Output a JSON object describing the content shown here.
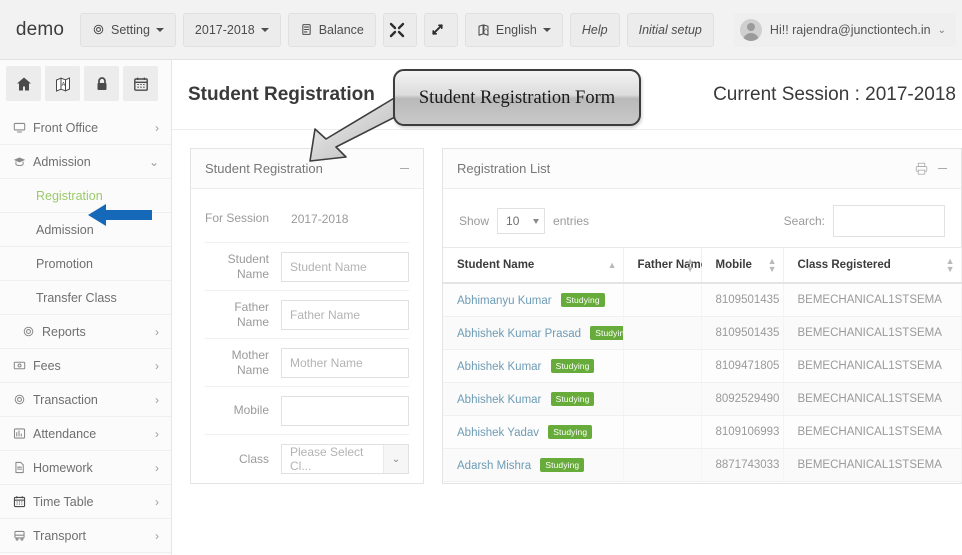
{
  "topbar": {
    "brand": "demo",
    "buttons": [
      {
        "label": "Setting",
        "icon": "gear-icon",
        "caret": true,
        "name": "setting-button"
      },
      {
        "label": "2017-2018",
        "icon": "",
        "caret": true,
        "name": "session-button"
      },
      {
        "label": "Balance",
        "icon": "database-icon",
        "caret": false,
        "name": "balance-button"
      },
      {
        "label": "",
        "icon": "expand-icon",
        "caret": false,
        "name": "expand-button"
      },
      {
        "label": "",
        "icon": "resize-icon",
        "caret": false,
        "name": "resize-button"
      },
      {
        "label": "English",
        "icon": "language-icon",
        "caret": true,
        "name": "language-button"
      },
      {
        "label": "Help",
        "icon": "",
        "caret": false,
        "name": "help-button"
      },
      {
        "label": "Initial setup",
        "icon": "",
        "caret": false,
        "name": "initial-setup-button"
      }
    ],
    "user": {
      "greeting": "Hi!! rajendra@junctiontech.in",
      "caret": "⌄"
    }
  },
  "sidebar": {
    "quick_icons": [
      "home-icon",
      "map-icon",
      "lock-icon",
      "calendar-icon"
    ],
    "items": [
      {
        "label": "Front Office",
        "icon": "monitor-icon",
        "chevron": "›",
        "sub": false,
        "active": false
      },
      {
        "label": "Admission",
        "icon": "graduation-cap-icon",
        "chevron": "⌄",
        "sub": false,
        "active": false
      },
      {
        "label": "Registration",
        "icon": "",
        "chevron": "",
        "sub": true,
        "active": true
      },
      {
        "label": "Admission",
        "icon": "",
        "chevron": "",
        "sub": true,
        "active": false
      },
      {
        "label": "Promotion",
        "icon": "",
        "chevron": "",
        "sub": true,
        "active": false
      },
      {
        "label": "Transfer Class",
        "icon": "",
        "chevron": "",
        "sub": true,
        "active": false
      },
      {
        "label": "Reports",
        "icon": "gear-icon",
        "chevron": "›",
        "sub": true,
        "active": false
      },
      {
        "label": "Fees",
        "icon": "money-icon",
        "chevron": "›",
        "sub": false,
        "active": false
      },
      {
        "label": "Transaction",
        "icon": "gear-icon",
        "chevron": "›",
        "sub": false,
        "active": false
      },
      {
        "label": "Attendance",
        "icon": "chart-icon",
        "chevron": "›",
        "sub": false,
        "active": false
      },
      {
        "label": "Homework",
        "icon": "document-icon",
        "chevron": "›",
        "sub": false,
        "active": false
      },
      {
        "label": "Time Table",
        "icon": "calendar-icon",
        "chevron": "›",
        "sub": false,
        "active": false
      },
      {
        "label": "Transport",
        "icon": "bus-icon",
        "chevron": "›",
        "sub": false,
        "active": false
      }
    ]
  },
  "page": {
    "title": "Student Registration",
    "session": "Current Session : 2017-2018"
  },
  "callout": {
    "text": "Student Registration Form"
  },
  "form_panel": {
    "title": "Student Registration",
    "collapse_icon": "minimize-icon",
    "session_label": "For Session",
    "session_value": "2017-2018",
    "fields": [
      {
        "label": "Student Name",
        "placeholder": "Student Name",
        "type": "text",
        "name": "student-name-input"
      },
      {
        "label": "Father Name",
        "placeholder": "Father Name",
        "type": "text",
        "name": "father-name-input"
      },
      {
        "label": "Mother Name",
        "placeholder": "Mother Name",
        "type": "text",
        "name": "mother-name-input"
      },
      {
        "label": "Mobile",
        "placeholder": "",
        "type": "text",
        "name": "mobile-input"
      },
      {
        "label": "Class",
        "placeholder": "Please Select Cl...",
        "type": "select",
        "name": "class-select"
      }
    ]
  },
  "list_panel": {
    "title": "Registration List",
    "print_icon": "print-icon",
    "collapse_icon": "minimize-icon",
    "show_label": "Show",
    "entries_label": "entries",
    "page_length": "10",
    "search_label": "Search:",
    "search_value": "",
    "columns": [
      {
        "label": "Student Name",
        "sort": "asc"
      },
      {
        "label": "Father Name",
        "sort": "both"
      },
      {
        "label": "Mobile",
        "sort": "both"
      },
      {
        "label": "Class Registered",
        "sort": "both"
      }
    ],
    "rows": [
      {
        "student": "Abhimanyu Kumar",
        "badge": "Studying",
        "father": "",
        "mobile": "8109501435",
        "class": "BEMECHANICAL1STSEMA"
      },
      {
        "student": "Abhishek Kumar Prasad",
        "badge": "Studying",
        "father": "",
        "mobile": "8109501435",
        "class": "BEMECHANICAL1STSEMA"
      },
      {
        "student": "Abhishek Kumar",
        "badge": "Studying",
        "father": "",
        "mobile": "8109471805",
        "class": "BEMECHANICAL1STSEMA"
      },
      {
        "student": "Abhishek Kumar",
        "badge": "Studying",
        "father": "",
        "mobile": "8092529490",
        "class": "BEMECHANICAL1STSEMA"
      },
      {
        "student": "Abhishek Yadav",
        "badge": "Studying",
        "father": "",
        "mobile": "8109106993",
        "class": "BEMECHANICAL1STSEMA"
      },
      {
        "student": "Adarsh Mishra",
        "badge": "Studying",
        "father": "",
        "mobile": "8871743033",
        "class": "BEMECHANICAL1STSEMA"
      }
    ]
  },
  "colors": {
    "accent_green": "#67ab3a",
    "link_blue": "#6d9cb5",
    "arrow_blue": "#1668b8",
    "topbar_bg": "#f2f2f2",
    "sidebar_bg": "#fbfbfb"
  }
}
